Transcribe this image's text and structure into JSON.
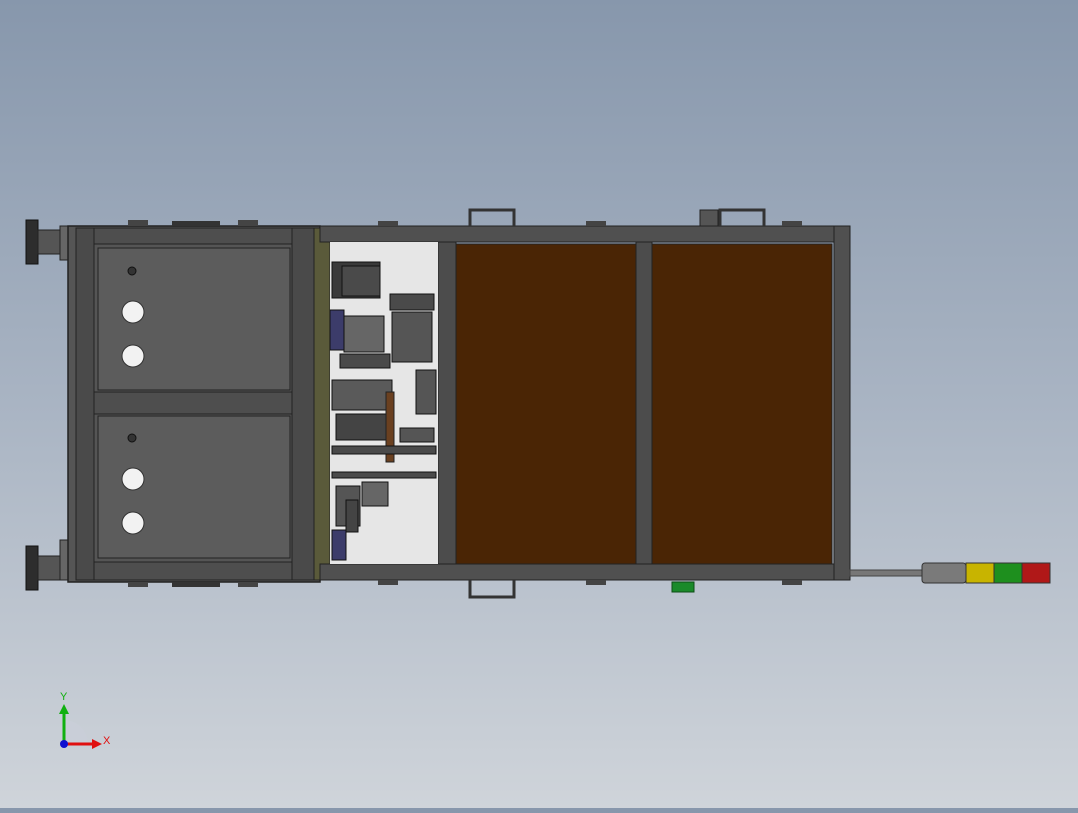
{
  "viewport": {
    "background_top": "#8797ac",
    "background_bottom": "#cfd4da"
  },
  "model": {
    "frame_color": "#4a4a4a",
    "panel_color": "#5a5a5a",
    "window_color": "#4a2505",
    "tower_light_colors": [
      "#7a7a7a",
      "#c8b400",
      "#1e8f1e",
      "#b01818"
    ]
  },
  "triad": {
    "x_label": "X",
    "y_label": "Y",
    "x_color": "#e01010",
    "y_color": "#10b010",
    "z_color": "#1010d0",
    "x_icon": "x-axis-arrow-icon",
    "y_icon": "y-axis-arrow-icon",
    "z_icon": "z-axis-dot-icon"
  }
}
